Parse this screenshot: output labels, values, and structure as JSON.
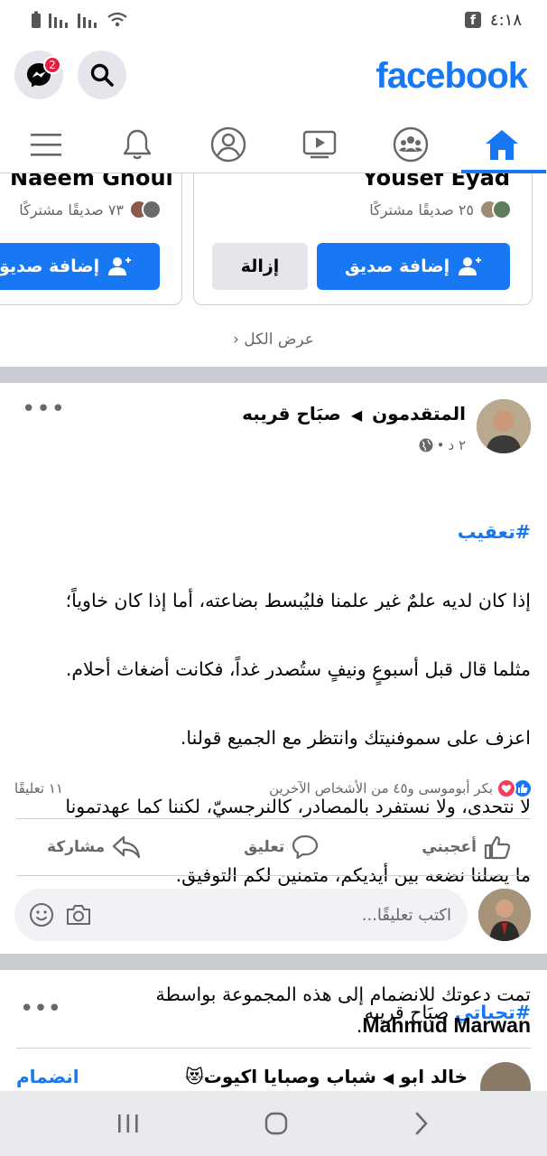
{
  "status_bar": {
    "time": "٤:١٨",
    "icons": [
      "battery-icon",
      "signal-icon",
      "signal-icon",
      "wifi-icon"
    ],
    "app_icon": "facebook-square-icon"
  },
  "top_bar": {
    "logo": "facebook",
    "messenger_badge": "2",
    "icons": [
      "messenger-icon",
      "search-icon"
    ],
    "brand_color": "#1877f2"
  },
  "nav": {
    "items": [
      "menu-icon",
      "bell-icon",
      "profile-icon",
      "watch-icon",
      "groups-icon",
      "home-icon"
    ],
    "active": "home-icon"
  },
  "suggestions": {
    "cards": [
      {
        "name": "Yousef Eyad",
        "mutual": "٢٥ صديقًا مشتركًا",
        "add_label": "إضافة صديق",
        "remove_label": "إزالة"
      },
      {
        "name": "Naeem Ghoul",
        "mutual": "٧٣ صديقًا مشتركًا",
        "add_label": "إضافة صديق"
      }
    ],
    "see_all": "عرض الكل"
  },
  "post": {
    "group": "المتقدمون",
    "author": "صبَاح قريبه",
    "time": "٢ د",
    "hashtag_top": "#تعقيب",
    "line1": "إذا كان لديه علمٌ غير علمنا فليُبسط بضاعته، أما إذا كان خاوياً؛",
    "line2": "مثلما قال قبل أسبوعٍ ونيفٍ ستُصدر غداً، فكانت أضغاث أحلام.",
    "line3": "اعزف على سموفنيتك وانتظر مع الجميع قولنا.",
    "line4": "لا نتحدى، ولا نستفرد بالمصادر، كالنرجسيّ، لكننا كما عهدتمونا",
    "line5": "ما يصلنا نضعه بين أيديكم، متمنين لكم التوفيق.",
    "hashtag_bottom": "#تحياتي",
    "signature": "صبَاح قريبه",
    "reactions_text": "بكر أبوموسى و٤٥ من الأشخاص الآخرين",
    "comments_count": "١١ تعليقًا",
    "like_label": "أعجبني",
    "comment_label": "تعليق",
    "share_label": "مشاركة",
    "comment_placeholder": "اكتب تعليقًا..."
  },
  "invite": {
    "text": "تمت دعوتك للانضمام إلى هذه المجموعة بواسطة",
    "inviter": "Mahmud Marwan",
    "group_title": "شباب وصبايا اكيوت😻",
    "author_partial": "خالد ابو",
    "join_label": "انضمام"
  },
  "system_nav": [
    "recents-icon",
    "home-circle-icon",
    "back-chevron-icon"
  ]
}
